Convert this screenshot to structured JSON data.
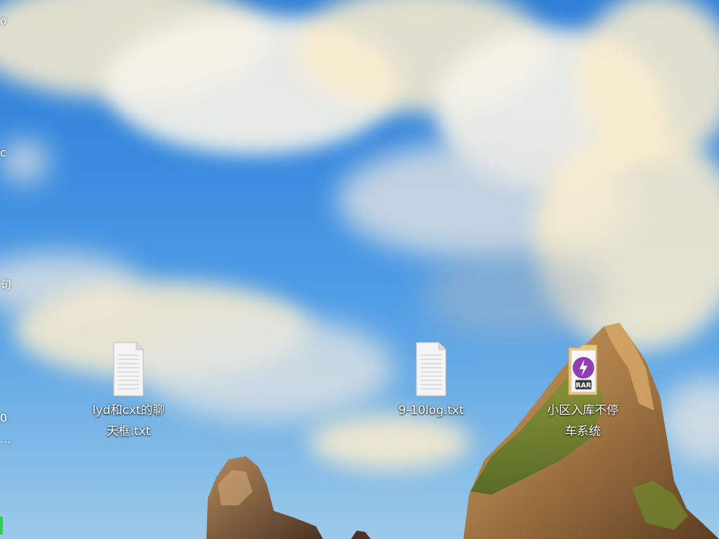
{
  "desktop": {
    "icons": [
      {
        "label": "lyd和cxt的聊天框.txt",
        "type": "text-file-icon"
      },
      {
        "label": "9-10log.txt",
        "type": "text-file-icon"
      },
      {
        "label": "小区入库不停车系统",
        "type": "rar-archive-icon"
      }
    ],
    "edge_fragments": [
      "o",
      "c",
      "句",
      "0",
      "..."
    ]
  },
  "colors": {
    "sky_top": "#2f7fd6",
    "sky_bottom": "#9cc9e8",
    "rar_badge": "#8e3fb0",
    "taskbar_marker": "#2fd04a"
  }
}
